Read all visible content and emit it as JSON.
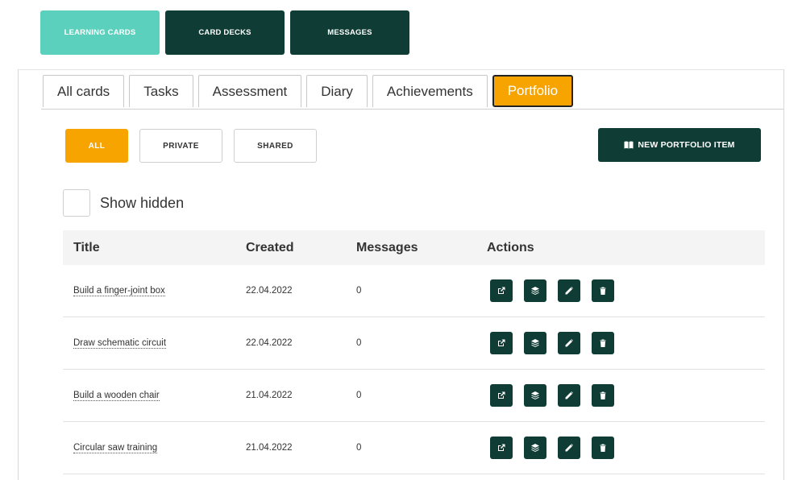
{
  "topnav": {
    "learning_cards": "LEARNING CARDS",
    "card_decks": "CARD DECKS",
    "messages": "MESSAGES"
  },
  "tabs": [
    "All cards",
    "Tasks",
    "Assessment",
    "Diary",
    "Achievements",
    "Portfolio"
  ],
  "active_tab": "Portfolio",
  "filters": {
    "all": "ALL",
    "private": "PRIVATE",
    "shared": "SHARED"
  },
  "new_item_label": "NEW PORTFOLIO ITEM",
  "show_hidden_label": "Show hidden",
  "table": {
    "headers": {
      "title": "Title",
      "created": "Created",
      "messages": "Messages",
      "actions": "Actions"
    },
    "rows": [
      {
        "title": "Build a finger-joint box",
        "created": "22.04.2022",
        "messages": "0"
      },
      {
        "title": "Draw schematic circuit",
        "created": "22.04.2022",
        "messages": "0"
      },
      {
        "title": "Build a wooden chair",
        "created": "21.04.2022",
        "messages": "0"
      },
      {
        "title": "Circular saw training",
        "created": "21.04.2022",
        "messages": "0"
      }
    ]
  },
  "icons": {
    "new_item": "book-open-icon",
    "actions": [
      "external-link-icon",
      "layers-icon",
      "pencil-icon",
      "trash-icon"
    ]
  },
  "colors": {
    "dark_green": "#0f3d35",
    "teal": "#5bd0bc",
    "orange": "#f7a400"
  }
}
